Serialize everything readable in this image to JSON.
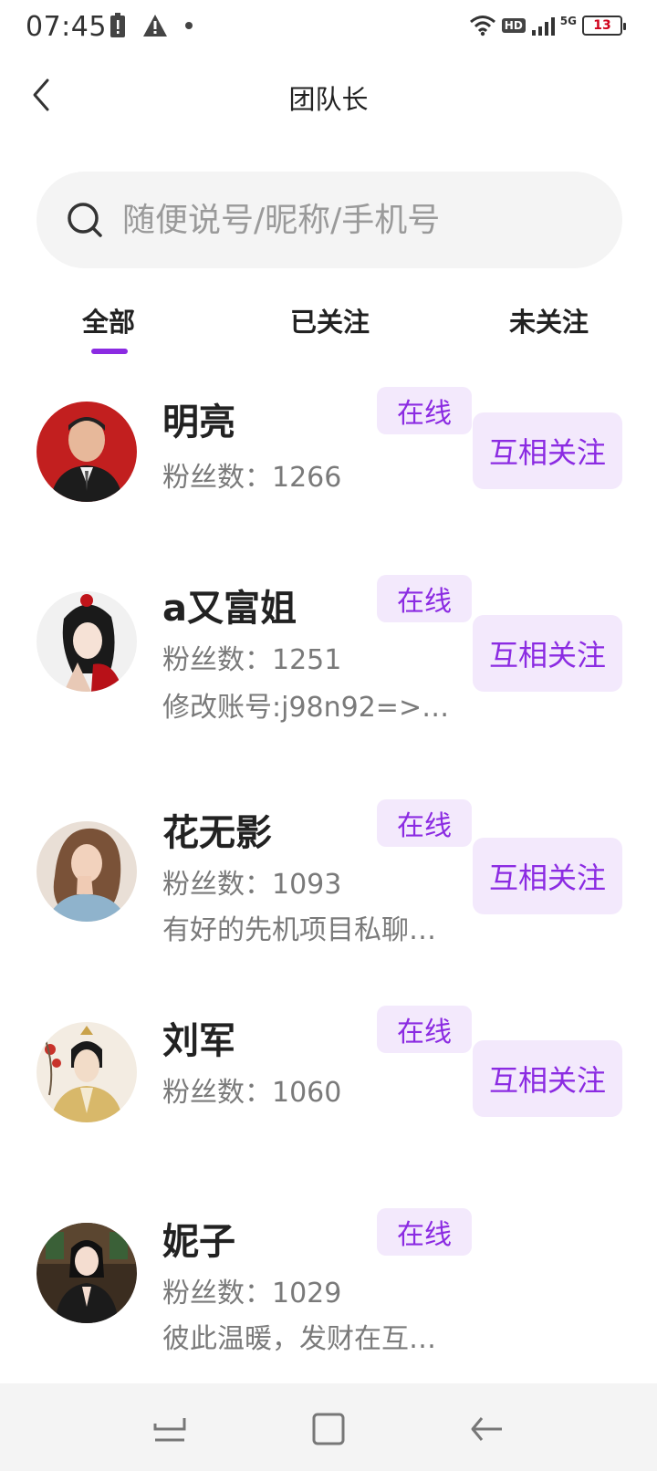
{
  "status_bar": {
    "time": "07:45",
    "network": "5G",
    "hd": "HD",
    "battery": "13"
  },
  "header": {
    "title": "团队长"
  },
  "search": {
    "placeholder": "随便说号/昵称/手机号"
  },
  "tabs": [
    {
      "label": "全部",
      "active": true
    },
    {
      "label": "已关注",
      "active": false
    },
    {
      "label": "未关注",
      "active": false
    }
  ],
  "users": [
    {
      "name": "明亮",
      "status": "在线",
      "fans": "粉丝数：1266",
      "bio": "",
      "action": "互相关注"
    },
    {
      "name": "a又富姐",
      "status": "在线",
      "fans": "粉丝数：1251",
      "bio": "修改账号:j98n92=>1…",
      "action": "互相关注"
    },
    {
      "name": "花无影",
      "status": "在线",
      "fans": "粉丝数：1093",
      "bio": "有好的先机项目私聊…",
      "action": "互相关注"
    },
    {
      "name": "刘军",
      "status": "在线",
      "fans": "粉丝数：1060",
      "bio": "",
      "action": "互相关注"
    },
    {
      "name": "妮子",
      "status": "在线",
      "fans": "粉丝数：1029",
      "bio": "彼此温暖，发财在互…",
      "action": ""
    }
  ],
  "colors": {
    "accent": "#8b2be2",
    "accent_bg": "#f3e9fc"
  },
  "icons": {
    "back": "back-arrow-icon",
    "search": "search-icon",
    "nav_recent": "recent-apps-icon",
    "nav_home": "home-icon",
    "nav_back": "back-icon"
  }
}
